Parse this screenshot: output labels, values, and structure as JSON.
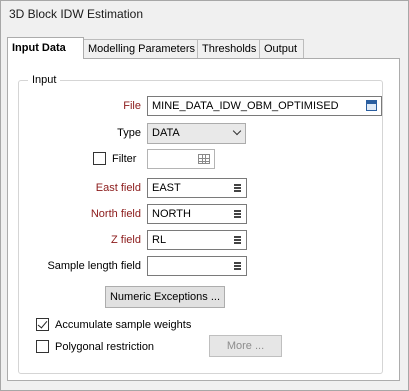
{
  "window": {
    "title": "3D Block IDW Estimation"
  },
  "tabs": [
    {
      "label": "Input Data",
      "active": true
    },
    {
      "label": "Modelling Parameters",
      "active": false
    },
    {
      "label": "Thresholds",
      "active": false
    },
    {
      "label": "Output",
      "active": false
    }
  ],
  "input_group": {
    "label": "Input",
    "file": {
      "label": "File",
      "value": "MINE_DATA_IDW_OBM_OPTIMISED"
    },
    "type": {
      "label": "Type",
      "value": "DATA"
    },
    "filter": {
      "label": "Filter",
      "checked": false,
      "value": ""
    },
    "east_field": {
      "label": "East field",
      "value": "EAST"
    },
    "north_field": {
      "label": "North field",
      "value": "NORTH"
    },
    "z_field": {
      "label": "Z field",
      "value": "RL"
    },
    "sample_length_field": {
      "label": "Sample length field",
      "value": ""
    },
    "numeric_exceptions_button": "Numeric Exceptions ...",
    "accumulate_sample_weights": {
      "label": "Accumulate sample weights",
      "checked": true
    },
    "polygonal_restriction": {
      "label": "Polygonal restriction",
      "checked": false
    },
    "more_button": "More ..."
  },
  "colors": {
    "required_label": "#8b1a1a",
    "browse_icon": "#2a5e9f"
  }
}
